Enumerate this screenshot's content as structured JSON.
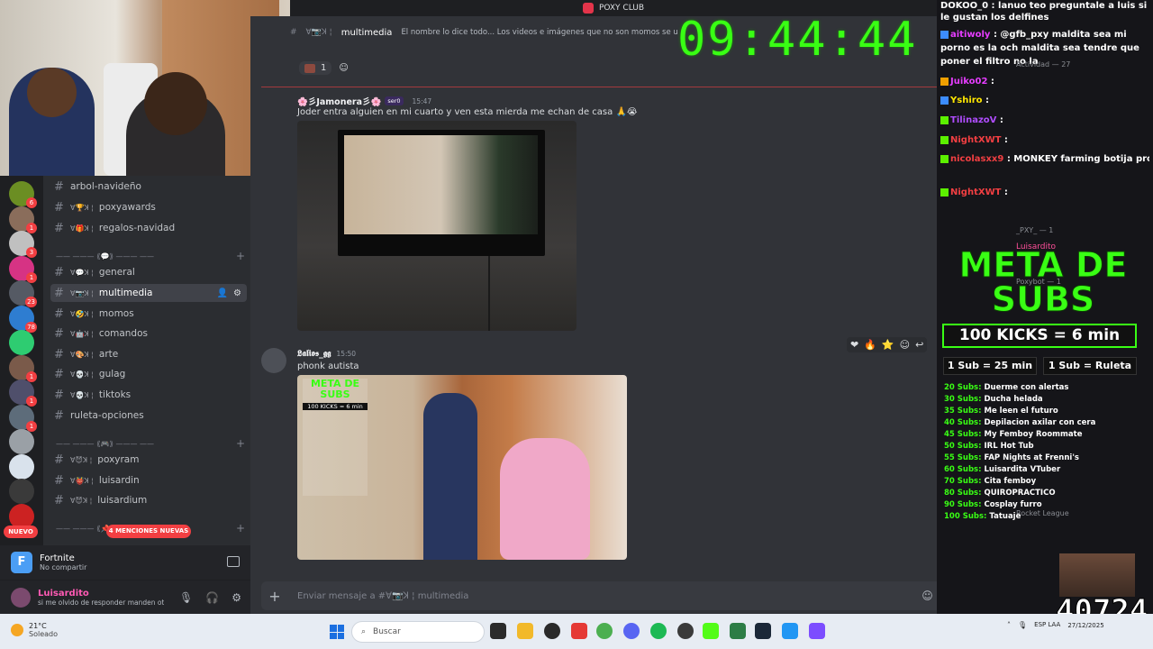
{
  "window": {
    "title": "POXY CLUB"
  },
  "servers": [
    {
      "badge": "6"
    },
    {
      "badge": "1"
    },
    {
      "badge": "3"
    },
    {
      "badge": "1"
    },
    {
      "badge": "23"
    },
    {
      "badge": "78"
    },
    {
      "badge": ""
    },
    {
      "badge": "1"
    },
    {
      "badge": "1"
    },
    {
      "badge": "1"
    },
    {
      "badge": ""
    },
    {
      "badge": ""
    },
    {
      "badge": ""
    },
    {
      "badge": ""
    }
  ],
  "server_new_label": "NUEVO",
  "channels": [
    {
      "name": "arbol-navideño",
      "prefix": ""
    },
    {
      "name": "poxyawards",
      "prefix": "ꓯ🏆ꓘ ¦"
    },
    {
      "name": "regalos-navidad",
      "prefix": "ꓯ🎁ꓘ ¦"
    },
    {
      "name": "general",
      "prefix": "ꓯ💬ꓘ ¦"
    },
    {
      "name": "multimedia",
      "prefix": "ꓯ📷ꓘ ¦"
    },
    {
      "name": "momos",
      "prefix": "ꓯ🤣ꓘ ¦"
    },
    {
      "name": "comandos",
      "prefix": "ꓯ🤖ꓘ ¦"
    },
    {
      "name": "arte",
      "prefix": "ꓯ🎨ꓘ ¦"
    },
    {
      "name": "gulag",
      "prefix": "ꓯ💀ꓘ ¦"
    },
    {
      "name": "tiktoks",
      "prefix": "ꓯ💀ꓘ ¦"
    },
    {
      "name": "ruleta-opciones",
      "prefix": ""
    },
    {
      "name": "poxyram",
      "prefix": "ꓯ😈ꓘ ¦"
    },
    {
      "name": "luisardin",
      "prefix": "ꓯ👹ꓘ ¦"
    },
    {
      "name": "luisardium",
      "prefix": "ꓯ😈ꓘ ¦"
    }
  ],
  "categories": [
    {
      "label": "—— ——— ⟪💬⟫ ——— ——"
    },
    {
      "label": "—— ——— ⟪🎮⟫ ——— ——"
    },
    {
      "label": "—— ——— ⟪📌⟫ ——— ——"
    }
  ],
  "mentions_label": "4 MENCIONES NUEVAS",
  "activity": {
    "game": "Fortnite",
    "detail": "No compartir"
  },
  "user": {
    "name": "Luisardito",
    "status": "si me olvido de responder manden otro ..."
  },
  "chat": {
    "channel": "multimedia",
    "channel_prefix": "ꓯ📷ꓘ ¦",
    "topic": "El nombre lo dice todo... Los videos e imágenes que no son momos se ubican aquí",
    "top_reaction_count": "1",
    "messages": [
      {
        "author": "🌸彡Jamonera彡🌸",
        "tag": "ser0",
        "time": "15:47",
        "text": "Joder entra alguien en mi cuarto y ven esta mierda me echan de casa 🙏😭"
      },
      {
        "author": "𝕷𝖆𝖑𝖎𝖔𝖘_𝖌𝖌",
        "tag": "",
        "time": "15:50",
        "text": "phonk autista"
      }
    ],
    "composer_placeholder": "Enviar mensaje a #ꓯ📷ꓘ ¦ multimedia"
  },
  "overlay": {
    "clock": "09:44:44",
    "chat_lines": [
      {
        "user": "",
        "text": "DOKOO_0 : lanuo teo preguntale a luis si le gustan los delfines"
      },
      {
        "user": "aitiwoly",
        "text": ": @gfb_pxy maldita sea mi porno es la och maldita sea tendre que poner el filtro no la"
      },
      {
        "user": "Juiko02",
        "text": ":"
      },
      {
        "user": "Yshiro",
        "text": ":"
      },
      {
        "user": "TilinazoV",
        "text": ":"
      },
      {
        "user": "NightXWT",
        "text": ":"
      },
      {
        "user": "nicolasxx9",
        "text": ": MONKEY farming botija pro"
      },
      {
        "user": "NightXWT",
        "text": ":"
      }
    ],
    "meta_title": "META DE SUBS",
    "kicks": "100 KICKS = 6 min",
    "sub_a": "1 Sub = 25 min",
    "sub_b": "1 Sub = Ruleta",
    "goals": [
      {
        "n": "20 Subs:",
        "t": "Duerme con alertas"
      },
      {
        "n": "30 Subs:",
        "t": "Ducha helada"
      },
      {
        "n": "35 Subs:",
        "t": "Me leen el futuro"
      },
      {
        "n": "40 Subs:",
        "t": "Depilacion axilar con cera"
      },
      {
        "n": "45 Subs:",
        "t": "My Femboy Roommate"
      },
      {
        "n": "50 Subs:",
        "t": "IRL Hot Tub"
      },
      {
        "n": "55 Subs:",
        "t": "FAP Nights at Frenni's"
      },
      {
        "n": "60 Subs:",
        "t": "Luisardita VTuber"
      },
      {
        "n": "70 Subs:",
        "t": "Cita femboy"
      },
      {
        "n": "80 Subs:",
        "t": "QUIROPRACTICO"
      },
      {
        "n": "90 Subs:",
        "t": "Cosplay furro"
      },
      {
        "n": "100 Subs:",
        "t": "Tatuaje"
      }
    ],
    "sub_count": "40724",
    "stream_text": {
      "activity": "Actividad — 27",
      "members": "_PXY_ — 1",
      "luisardito": "Luisardito",
      "poxybot": "Poxybot — 1",
      "rocket": "Rocket League"
    }
  },
  "taskbar": {
    "temp": "21°C",
    "weather": "Soleado",
    "search_placeholder": "Buscar",
    "lang": "ESP LAA",
    "date": "27/12/2025"
  }
}
